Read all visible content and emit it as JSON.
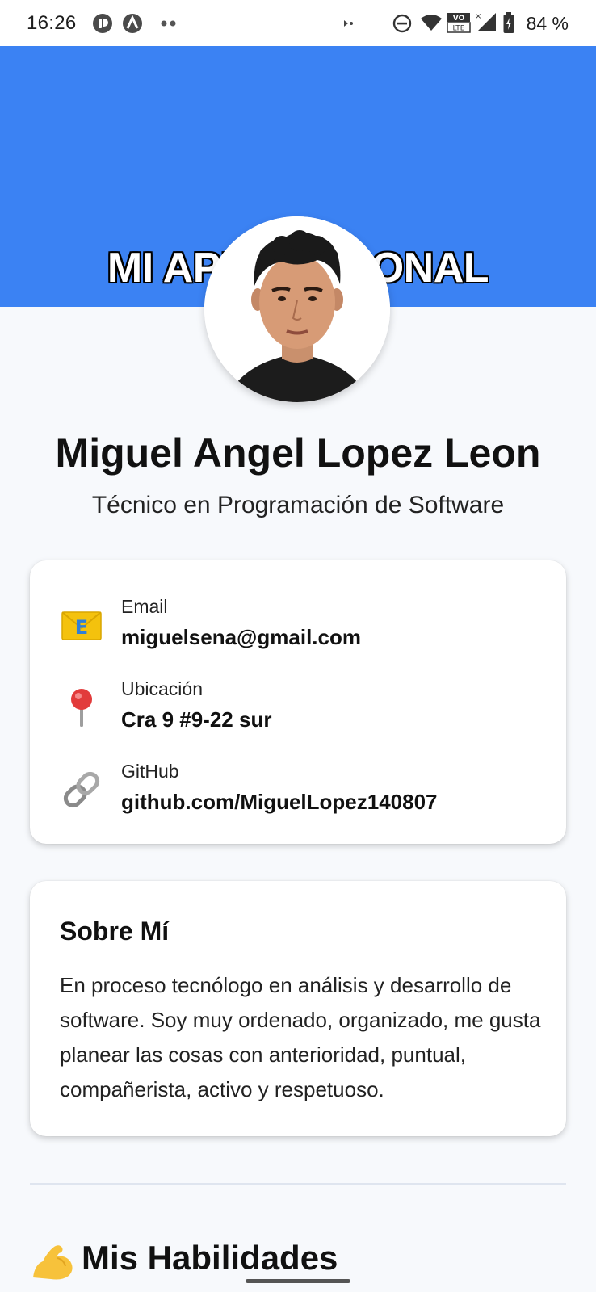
{
  "status_bar": {
    "time": "16:26",
    "battery_percent": "84 %",
    "icons": [
      "app-notification-icon",
      "arch-app-icon",
      "more-dots-icon",
      "data-saver-icon",
      "dnd-icon",
      "wifi-icon",
      "volte-icon",
      "cell-signal-icon",
      "battery-icon"
    ]
  },
  "header": {
    "title": "MI APP PERSONAL",
    "background_color": "#3b82f3"
  },
  "profile": {
    "name": "Miguel Angel Lopez Leon",
    "role": "Técnico en Programación de Software"
  },
  "contact": {
    "items": [
      {
        "label": "Email",
        "value": "miguelsena@gmail.com",
        "icon": "envelope-icon"
      },
      {
        "label": "Ubicación",
        "value": "Cra 9 #9-22 sur",
        "icon": "pushpin-icon"
      },
      {
        "label": "GitHub",
        "value": "github.com/MiguelLopez140807",
        "icon": "link-icon"
      }
    ]
  },
  "about": {
    "title": "Sobre Mí",
    "text": "En proceso tecnólogo en análisis y desarrollo de software. Soy muy ordenado, organizado, me gusta planear las cosas con anterioridad, puntual, compañerista, activo y respetuoso."
  },
  "skills": {
    "title": "Mis Habilidades",
    "icon": "flexed-biceps-icon"
  }
}
